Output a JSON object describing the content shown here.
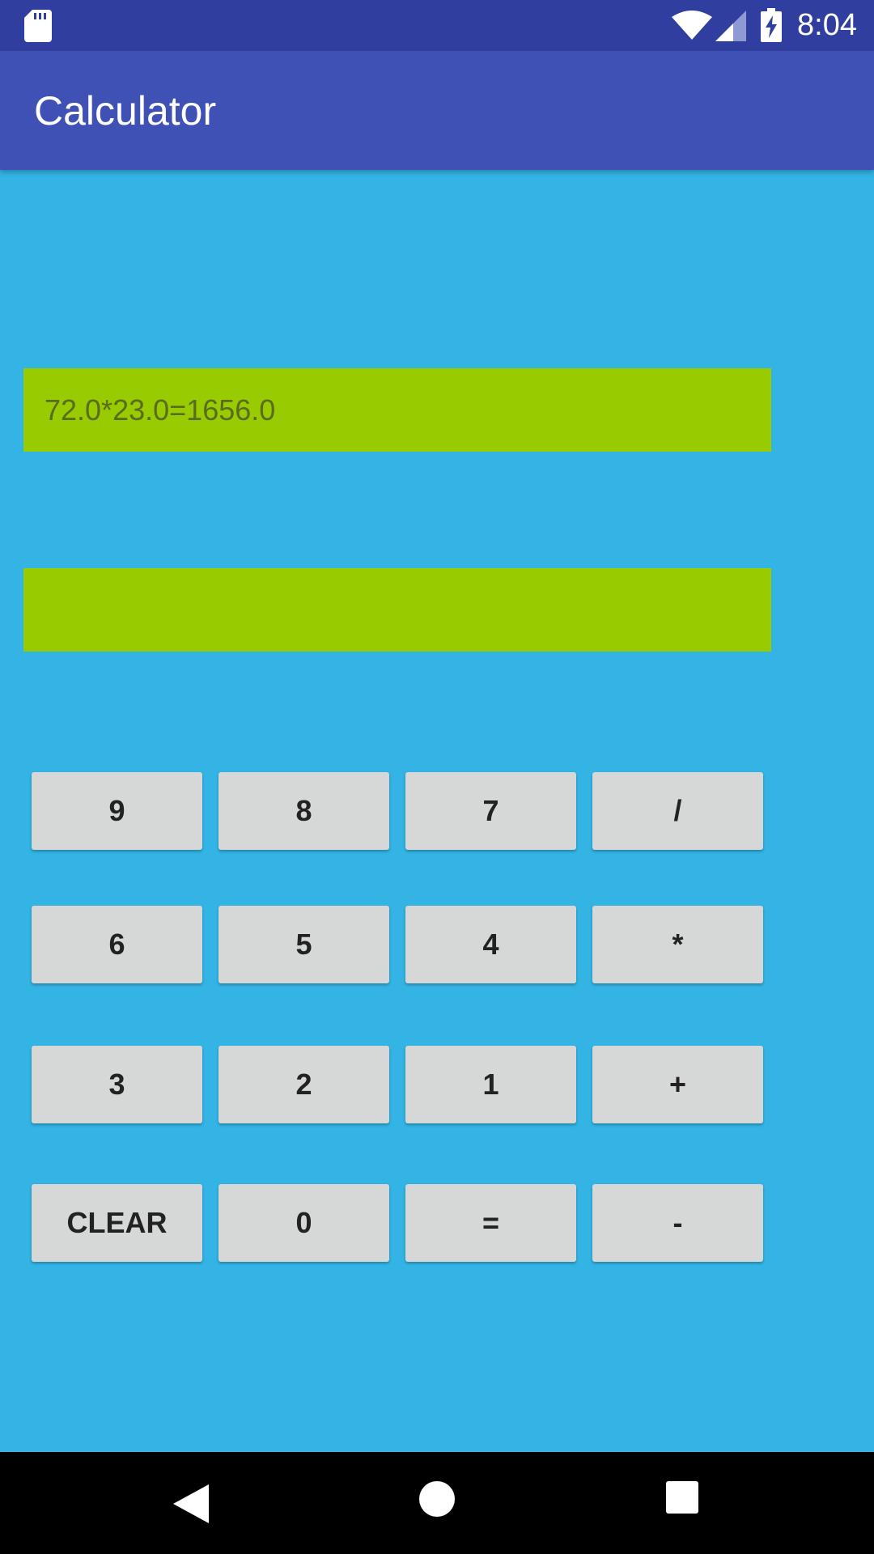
{
  "status_bar": {
    "time": "8:04",
    "icons": [
      "sd-card-icon",
      "wifi-icon",
      "cell-signal-icon",
      "battery-charging-icon"
    ]
  },
  "app_bar": {
    "title": "Calculator"
  },
  "display": {
    "expression": "72.0*23.0=1656.0",
    "input": ""
  },
  "keypad": {
    "rows": [
      [
        "9",
        "8",
        "7",
        "/"
      ],
      [
        "6",
        "5",
        "4",
        "*"
      ],
      [
        "3",
        "2",
        "1",
        "+"
      ],
      [
        "CLEAR",
        "0",
        "=",
        "-"
      ]
    ]
  },
  "nav_bar": {
    "icons": [
      "back-icon",
      "home-icon",
      "recent-apps-icon"
    ]
  },
  "colors": {
    "status_bar": "#303f9f",
    "app_bar": "#3f51b5",
    "background": "#33b4e4",
    "display_field": "#99cc00",
    "key": "#d6d7d7"
  }
}
